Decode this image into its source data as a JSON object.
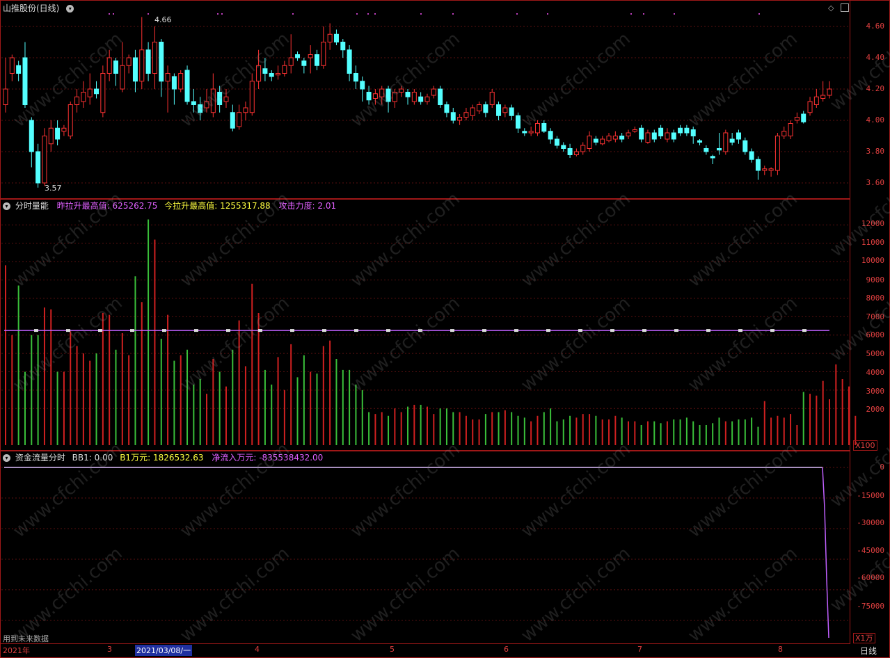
{
  "price_panel": {
    "title": "山推股份(日线)",
    "y_labels": [
      "4.60",
      "4.40",
      "4.20",
      "4.00",
      "3.80",
      "3.60"
    ],
    "y_values": [
      4.6,
      4.4,
      4.2,
      4.0,
      3.8,
      3.6
    ],
    "high_label": "4.66",
    "low_label": "3.57"
  },
  "volume_panel": {
    "title": "分时量能",
    "yest_label": "昨拉升最高值:",
    "yest_value": "625262.75",
    "today_label": "今拉升最高值:",
    "today_value": "1255317.88",
    "attack_label": "攻击力度:",
    "attack_value": "2.01",
    "y_labels": [
      "12000",
      "11000",
      "10000",
      "9000",
      "8000",
      "7000",
      "6000",
      "5000",
      "4000",
      "3000",
      "2000"
    ],
    "unit": "X100"
  },
  "money_panel": {
    "title": "资金流量分时",
    "bb1_label": "BB1:",
    "bb1_value": "0.00",
    "b1_label": "B1万元:",
    "b1_value": "1826532.63",
    "net_label": "净流入万元:",
    "net_value": "-835538432.00",
    "y_labels": [
      "0",
      "-15000",
      "-30000",
      "-45000",
      "-60000",
      "-75000"
    ],
    "unit": "X1万"
  },
  "footer": {
    "note": "用到未来数据",
    "dates": [
      "2021年",
      "3",
      "2021/03/08/一",
      "4",
      "5",
      "6",
      "7",
      "8"
    ],
    "period": "日线"
  },
  "watermark": "www.cfchi.com",
  "colors": {
    "up": "#ff3232",
    "down": "#54ffff",
    "vol_up": "#d02020",
    "vol_down": "#3ac03a",
    "line": "#c060ff",
    "frame": "#a01818"
  },
  "chart_data": {
    "type": "candlestick",
    "ylim": [
      3.55,
      4.68
    ],
    "candles": [
      [
        4.1,
        4.2,
        4.05,
        4.4
      ],
      [
        4.3,
        4.4,
        4.25,
        4.42
      ],
      [
        4.35,
        4.3,
        4.25,
        4.38
      ],
      [
        4.4,
        4.1,
        4.08,
        4.5
      ],
      [
        4.0,
        3.8,
        3.7,
        4.02
      ],
      [
        3.8,
        3.6,
        3.57,
        3.85
      ],
      [
        3.6,
        3.9,
        3.58,
        3.95
      ],
      [
        3.85,
        3.95,
        3.8,
        4.0
      ],
      [
        3.95,
        3.88,
        3.84,
        4.0
      ],
      [
        3.93,
        3.95,
        3.9,
        3.97
      ],
      [
        3.9,
        4.1,
        3.88,
        4.12
      ],
      [
        4.1,
        4.15,
        4.05,
        4.2
      ],
      [
        4.12,
        4.18,
        4.08,
        4.25
      ],
      [
        4.15,
        4.2,
        4.1,
        4.3
      ],
      [
        4.2,
        4.17,
        4.14,
        4.25
      ],
      [
        4.05,
        4.3,
        4.02,
        4.35
      ],
      [
        4.3,
        4.4,
        4.25,
        4.45
      ],
      [
        4.38,
        4.3,
        4.22,
        4.4
      ],
      [
        4.2,
        4.35,
        4.18,
        4.5
      ],
      [
        4.35,
        4.4,
        4.3,
        4.42
      ],
      [
        4.4,
        4.25,
        4.18,
        4.45
      ],
      [
        4.25,
        4.45,
        4.2,
        4.66
      ],
      [
        4.45,
        4.3,
        4.25,
        4.5
      ],
      [
        4.3,
        4.5,
        4.2,
        4.6
      ],
      [
        4.5,
        4.25,
        4.15,
        4.52
      ],
      [
        4.25,
        4.3,
        4.05,
        4.35
      ],
      [
        4.28,
        4.2,
        4.1,
        4.3
      ],
      [
        4.2,
        4.3,
        4.18,
        4.32
      ],
      [
        4.32,
        4.12,
        4.1,
        4.35
      ],
      [
        4.12,
        4.1,
        4.05,
        4.2
      ],
      [
        4.1,
        4.05,
        4.0,
        4.15
      ],
      [
        4.08,
        4.12,
        4.05,
        4.2
      ],
      [
        4.05,
        4.2,
        4.02,
        4.3
      ],
      [
        4.18,
        4.1,
        4.05,
        4.22
      ],
      [
        4.12,
        4.15,
        4.08,
        4.2
      ],
      [
        4.05,
        3.95,
        3.93,
        4.1
      ],
      [
        3.96,
        4.05,
        3.94,
        4.1
      ],
      [
        4.05,
        4.08,
        4.0,
        4.12
      ],
      [
        4.05,
        4.25,
        4.03,
        4.3
      ],
      [
        4.25,
        4.35,
        4.2,
        4.45
      ],
      [
        4.33,
        4.3,
        4.25,
        4.4
      ],
      [
        4.3,
        4.28,
        4.25,
        4.32
      ],
      [
        4.29,
        4.3,
        4.26,
        4.35
      ],
      [
        4.3,
        4.35,
        4.28,
        4.38
      ],
      [
        4.35,
        4.4,
        4.3,
        4.55
      ],
      [
        4.42,
        4.4,
        4.38,
        4.44
      ],
      [
        4.38,
        4.35,
        4.3,
        4.4
      ],
      [
        4.4,
        4.42,
        4.3,
        4.48
      ],
      [
        4.42,
        4.35,
        4.32,
        4.45
      ],
      [
        4.35,
        4.5,
        4.33,
        4.6
      ],
      [
        4.5,
        4.55,
        4.45,
        4.62
      ],
      [
        4.55,
        4.5,
        4.48,
        4.58
      ],
      [
        4.5,
        4.45,
        4.4,
        4.52
      ],
      [
        4.45,
        4.3,
        4.25,
        4.48
      ],
      [
        4.3,
        4.25,
        4.2,
        4.35
      ],
      [
        4.25,
        4.2,
        4.12,
        4.28
      ],
      [
        4.18,
        4.13,
        4.1,
        4.22
      ],
      [
        4.14,
        4.17,
        4.1,
        4.2
      ],
      [
        4.15,
        4.2,
        4.1,
        4.22
      ],
      [
        4.2,
        4.12,
        4.05,
        4.22
      ],
      [
        4.12,
        4.18,
        4.08,
        4.2
      ],
      [
        4.18,
        4.2,
        4.15,
        4.22
      ],
      [
        4.18,
        4.15,
        4.1,
        4.2
      ],
      [
        4.12,
        4.18,
        4.1,
        4.2
      ],
      [
        4.15,
        4.12,
        4.1,
        4.18
      ],
      [
        4.12,
        4.15,
        4.1,
        4.17
      ],
      [
        4.16,
        4.2,
        4.14,
        4.22
      ],
      [
        4.2,
        4.1,
        4.08,
        4.22
      ],
      [
        4.1,
        4.05,
        4.02,
        4.12
      ],
      [
        4.05,
        4.0,
        3.98,
        4.08
      ],
      [
        4.0,
        4.02,
        3.97,
        4.04
      ],
      [
        4.02,
        4.05,
        4.0,
        4.08
      ],
      [
        4.03,
        4.08,
        4.0,
        4.1
      ],
      [
        4.06,
        4.1,
        4.04,
        4.12
      ],
      [
        4.1,
        4.05,
        4.02,
        4.12
      ],
      [
        4.1,
        4.18,
        4.08,
        4.2
      ],
      [
        4.1,
        4.03,
        4.0,
        4.12
      ],
      [
        4.05,
        4.08,
        4.02,
        4.1
      ],
      [
        4.08,
        4.03,
        4.0,
        4.1
      ],
      [
        4.03,
        3.95,
        3.92,
        4.05
      ],
      [
        3.93,
        3.92,
        3.9,
        3.95
      ],
      [
        3.92,
        3.93,
        3.9,
        3.96
      ],
      [
        3.92,
        3.98,
        3.9,
        4.0
      ],
      [
        3.98,
        3.93,
        3.92,
        4.0
      ],
      [
        3.93,
        3.88,
        3.85,
        3.95
      ],
      [
        3.88,
        3.84,
        3.82,
        3.9
      ],
      [
        3.84,
        3.82,
        3.8,
        3.86
      ],
      [
        3.82,
        3.78,
        3.76,
        3.85
      ],
      [
        3.78,
        3.8,
        3.77,
        3.82
      ],
      [
        3.8,
        3.84,
        3.78,
        3.86
      ],
      [
        3.82,
        3.9,
        3.8,
        3.93
      ],
      [
        3.88,
        3.86,
        3.84,
        3.9
      ],
      [
        3.85,
        3.88,
        3.84,
        3.9
      ],
      [
        3.87,
        3.9,
        3.86,
        3.92
      ],
      [
        3.88,
        3.9,
        3.86,
        3.93
      ],
      [
        3.9,
        3.88,
        3.86,
        3.92
      ],
      [
        3.9,
        3.92,
        3.88,
        3.94
      ],
      [
        3.93,
        3.94,
        3.92,
        3.96
      ],
      [
        3.95,
        3.88,
        3.86,
        3.97
      ],
      [
        3.86,
        3.92,
        3.85,
        3.94
      ],
      [
        3.92,
        3.88,
        3.86,
        3.94
      ],
      [
        3.95,
        3.9,
        3.88,
        3.97
      ],
      [
        3.88,
        3.92,
        3.86,
        3.95
      ],
      [
        3.92,
        3.88,
        3.86,
        3.94
      ],
      [
        3.95,
        3.92,
        3.9,
        3.97
      ],
      [
        3.95,
        3.92,
        3.9,
        3.97
      ],
      [
        3.94,
        3.9,
        3.85,
        3.96
      ],
      [
        3.87,
        3.86,
        3.84,
        3.88
      ],
      [
        3.82,
        3.8,
        3.78,
        3.84
      ],
      [
        3.77,
        3.76,
        3.72,
        3.78
      ],
      [
        3.82,
        3.81,
        3.78,
        3.92
      ],
      [
        3.8,
        3.92,
        3.78,
        3.94
      ],
      [
        3.88,
        3.86,
        3.84,
        3.92
      ],
      [
        3.92,
        3.88,
        3.85,
        3.94
      ],
      [
        3.87,
        3.8,
        3.78,
        3.89
      ],
      [
        3.8,
        3.75,
        3.73,
        3.82
      ],
      [
        3.75,
        3.68,
        3.62,
        3.77
      ],
      [
        3.68,
        3.69,
        3.65,
        3.71
      ],
      [
        3.68,
        3.69,
        3.64,
        3.7
      ],
      [
        3.68,
        3.9,
        3.65,
        3.92
      ],
      [
        3.9,
        3.93,
        3.88,
        3.96
      ],
      [
        3.9,
        3.98,
        3.88,
        4.0
      ],
      [
        4.0,
        4.02,
        3.98,
        4.05
      ],
      [
        4.04,
        3.99,
        3.98,
        4.06
      ],
      [
        4.05,
        4.12,
        4.03,
        4.15
      ],
      [
        4.1,
        4.15,
        4.08,
        4.2
      ],
      [
        4.14,
        4.16,
        4.12,
        4.25
      ],
      [
        4.16,
        4.2,
        4.14,
        4.25
      ]
    ],
    "volume": [
      9800,
      6000,
      8700,
      4000,
      6000,
      6000,
      7500,
      7400,
      4000,
      4000,
      6200,
      5400,
      5000,
      4600,
      5000,
      7200,
      7100,
      5200,
      6100,
      4900,
      9200,
      7800,
      12300,
      11200,
      5800,
      7100,
      4600,
      4900,
      5200,
      3300,
      3600,
      2800,
      4700,
      4000,
      3200,
      5200,
      6800,
      4300,
      8800,
      7200,
      4100,
      3300,
      4800,
      3000,
      5500,
      3700,
      4900,
      4000,
      3900,
      5400,
      5700,
      4700,
      4100,
      4100,
      3300,
      3000,
      1800,
      1700,
      1800,
      1600,
      2000,
      1800,
      2100,
      2200,
      2200,
      2100,
      1700,
      2000,
      2000,
      1800,
      1800,
      1600,
      1400,
      1400,
      1700,
      1800,
      1800,
      1900,
      1800,
      1600,
      1500,
      1300,
      1600,
      1800,
      2000,
      1300,
      1400,
      1600,
      1500,
      1700,
      1700,
      1600,
      1400,
      1400,
      1600,
      1500,
      1300,
      1300,
      1100,
      1300,
      1300,
      1200,
      1300,
      1400,
      1400,
      1500,
      1300,
      1100,
      1100,
      1200,
      1500,
      1300,
      1300,
      1400,
      1400,
      1500,
      1000,
      2400,
      1500,
      1600,
      1500,
      1700,
      1100,
      2900,
      2800,
      2700,
      3500,
      2500,
      4400,
      3600,
      3200,
      1600
    ],
    "volume_ref_line": 6250,
    "money_flow_net": [
      0,
      0,
      0,
      0,
      0,
      0,
      0,
      0,
      0,
      0,
      0,
      0,
      0,
      0,
      0,
      0,
      0,
      0,
      0,
      0,
      0,
      0,
      0,
      0,
      0,
      0,
      0,
      0,
      0,
      0,
      0,
      0,
      0,
      0,
      -83553
    ]
  }
}
